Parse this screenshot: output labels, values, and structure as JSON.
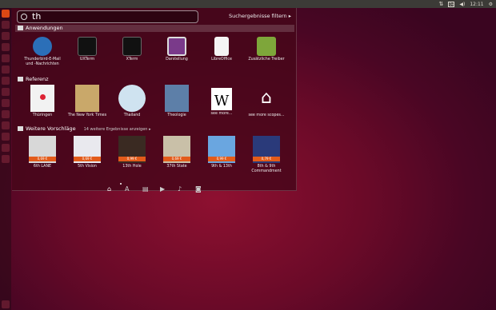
{
  "topbar": {
    "clock": "12:11",
    "keyboard": "De"
  },
  "search": {
    "query": "th",
    "filter_label": "Suchergebnisse filtern ▸"
  },
  "sections": {
    "apps": "Anwendungen",
    "reference": "Referenz",
    "more": "Weitere Vorschläge",
    "more_extra": "14 weitere Ergebnisse anzeigen ▸"
  },
  "apps": [
    {
      "label": "Thunderbird-E-Mail und -Nachrichten",
      "icon": "thunderbird-icon",
      "color": "#2b6fb8"
    },
    {
      "label": "UXTerm",
      "icon": "terminal-icon",
      "color": "#111111"
    },
    {
      "label": "XTerm",
      "icon": "terminal-icon",
      "color": "#111111"
    },
    {
      "label": "Darstellung",
      "icon": "display-icon",
      "color": "#7a3a8a"
    },
    {
      "label": "LibreOffice",
      "icon": "document-icon",
      "color": "#f4f4f4"
    },
    {
      "label": "Zusätzliche Treiber",
      "icon": "driver-icon",
      "color": "#7ea63a"
    }
  ],
  "references": [
    {
      "label": "Thüringen",
      "color": "#f2f2f2"
    },
    {
      "label": "The New York Times",
      "color": "#c9a86a"
    },
    {
      "label": "Thailand",
      "color": "#cfe3f0"
    },
    {
      "label": "Theologie",
      "color": "#5d7fa8"
    },
    {
      "label": "see more...",
      "color": "#ffffff"
    },
    {
      "label": "see more scopes...",
      "color": "#ffffff"
    }
  ],
  "albums": [
    {
      "label": "6th LANE",
      "price": "0,69 €",
      "color": "#d8d8d8"
    },
    {
      "label": "5th Vision",
      "price": "0,69 €",
      "color": "#e9e9ee"
    },
    {
      "label": "13th Hole",
      "price": "0,99 €",
      "color": "#3a2a22"
    },
    {
      "label": "37th State",
      "price": "0,69 €",
      "color": "#c9c0a8"
    },
    {
      "label": "9th & 13th",
      "price": "0,99 €",
      "color": "#6aa6e0"
    },
    {
      "label": "8th & 9th Commandment",
      "price": "0,79 €",
      "color": "#2a3a7a"
    }
  ]
}
